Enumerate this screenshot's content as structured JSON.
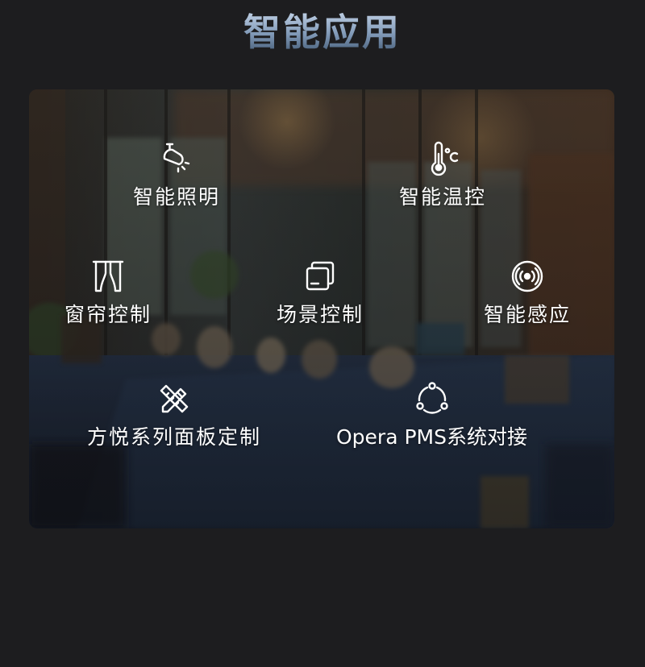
{
  "page": {
    "title": "智能应用"
  },
  "features": [
    {
      "label": "智能照明",
      "icon": "lighting-icon"
    },
    {
      "label": "智能温控",
      "icon": "thermometer-icon"
    },
    {
      "label": "窗帘控制",
      "icon": "curtain-icon"
    },
    {
      "label": "场景控制",
      "icon": "scene-icon"
    },
    {
      "label": "智能感应",
      "icon": "sensor-icon"
    },
    {
      "label": "方悦系列面板定制",
      "icon": "design-tools-icon"
    },
    {
      "label": "Opera PMS系统对接",
      "icon": "system-link-icon"
    }
  ],
  "colors": {
    "background": "#1d1d1f",
    "label": "#ffffff",
    "title_gradient_top": "#c9d9ec",
    "title_gradient_bottom": "#3e556f"
  }
}
